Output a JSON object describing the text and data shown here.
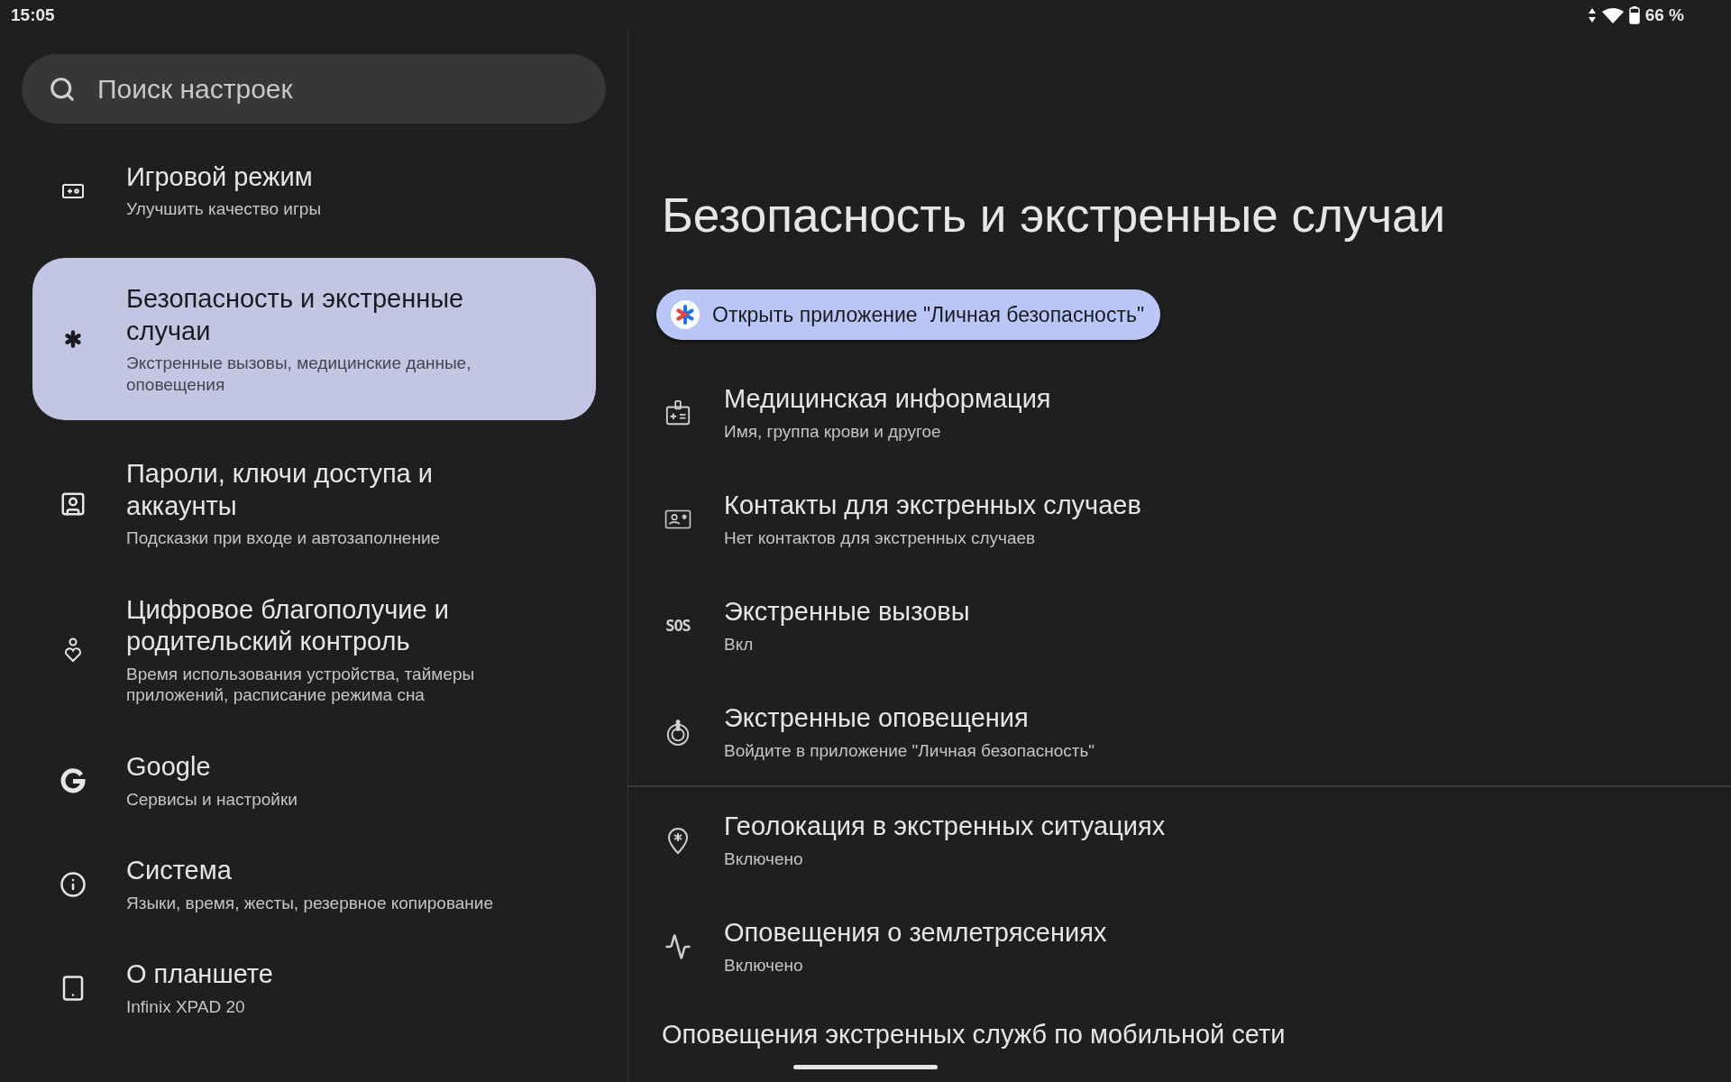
{
  "status_bar": {
    "time": "15:05",
    "battery": "66 %"
  },
  "search": {
    "placeholder": "Поиск настроек"
  },
  "sidebar": {
    "items": [
      {
        "title": "Игровой режим",
        "subtitle": "Улучшить качество игры",
        "selected": false
      },
      {
        "title": "Безопасность и экстренные случаи",
        "subtitle": "Экстренные вызовы, медицинские данные, оповещения",
        "selected": true
      },
      {
        "title": "Пароли, ключи доступа и аккаунты",
        "subtitle": "Подсказки при входе и автозаполнение",
        "selected": false
      },
      {
        "title": "Цифровое благополучие и родительский контроль",
        "subtitle": "Время использования устройства, таймеры приложений, расписание режима сна",
        "selected": false
      },
      {
        "title": "Google",
        "subtitle": "Сервисы и настройки",
        "selected": false
      },
      {
        "title": "Система",
        "subtitle": "Языки, время, жесты, резервное копирование",
        "selected": false
      },
      {
        "title": "О планшете",
        "subtitle": "Infinix XPAD 20",
        "selected": false
      }
    ]
  },
  "page": {
    "title": "Безопасность и экстренные случаи",
    "app_button": "Открыть приложение \"Личная безопасность\"",
    "groups": [
      {
        "rows": [
          {
            "title": "Медицинская информация",
            "subtitle": "Имя, группа крови и другое"
          },
          {
            "title": "Контакты для экстренных случаев",
            "subtitle": "Нет контактов для экстренных случаев"
          },
          {
            "title": "Экстренные вызовы",
            "subtitle": "Вкл",
            "icon_text": "SOS"
          },
          {
            "title": "Экстренные оповещения",
            "subtitle": "Войдите в приложение \"Личная безопасность\""
          }
        ]
      },
      {
        "rows": [
          {
            "title": "Геолокация в экстренных ситуациях",
            "subtitle": "Включено"
          },
          {
            "title": "Оповещения о землетрясениях",
            "subtitle": "Включено"
          }
        ]
      }
    ],
    "section_header": "Оповещения экстренных служб по мобильной сети"
  }
}
